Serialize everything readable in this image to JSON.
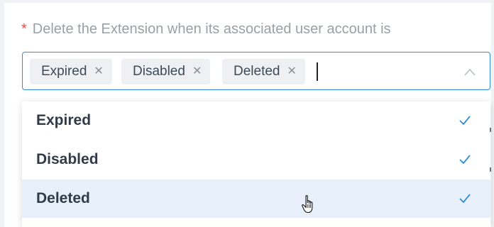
{
  "field": {
    "required_marker": "*",
    "label": "Delete the Extension when its associated user account is"
  },
  "select": {
    "tags": [
      {
        "label": "Expired",
        "remove_icon": "close-icon"
      },
      {
        "label": "Disabled",
        "remove_icon": "close-icon"
      },
      {
        "label": "Deleted",
        "remove_icon": "close-icon"
      }
    ],
    "toggle_icon": "chevron-up-icon",
    "expanded": true
  },
  "dropdown": {
    "options": [
      {
        "label": "Expired",
        "selected": true,
        "hovered": false
      },
      {
        "label": "Disabled",
        "selected": true,
        "hovered": false
      },
      {
        "label": "Deleted",
        "selected": true,
        "hovered": true
      }
    ],
    "check_icon": "checkmark-icon"
  },
  "colors": {
    "accent": "#2f8fd8",
    "required": "#ef4b4b",
    "hover_bg": "#e8f1fb",
    "tag_bg": "#eef0f3"
  }
}
